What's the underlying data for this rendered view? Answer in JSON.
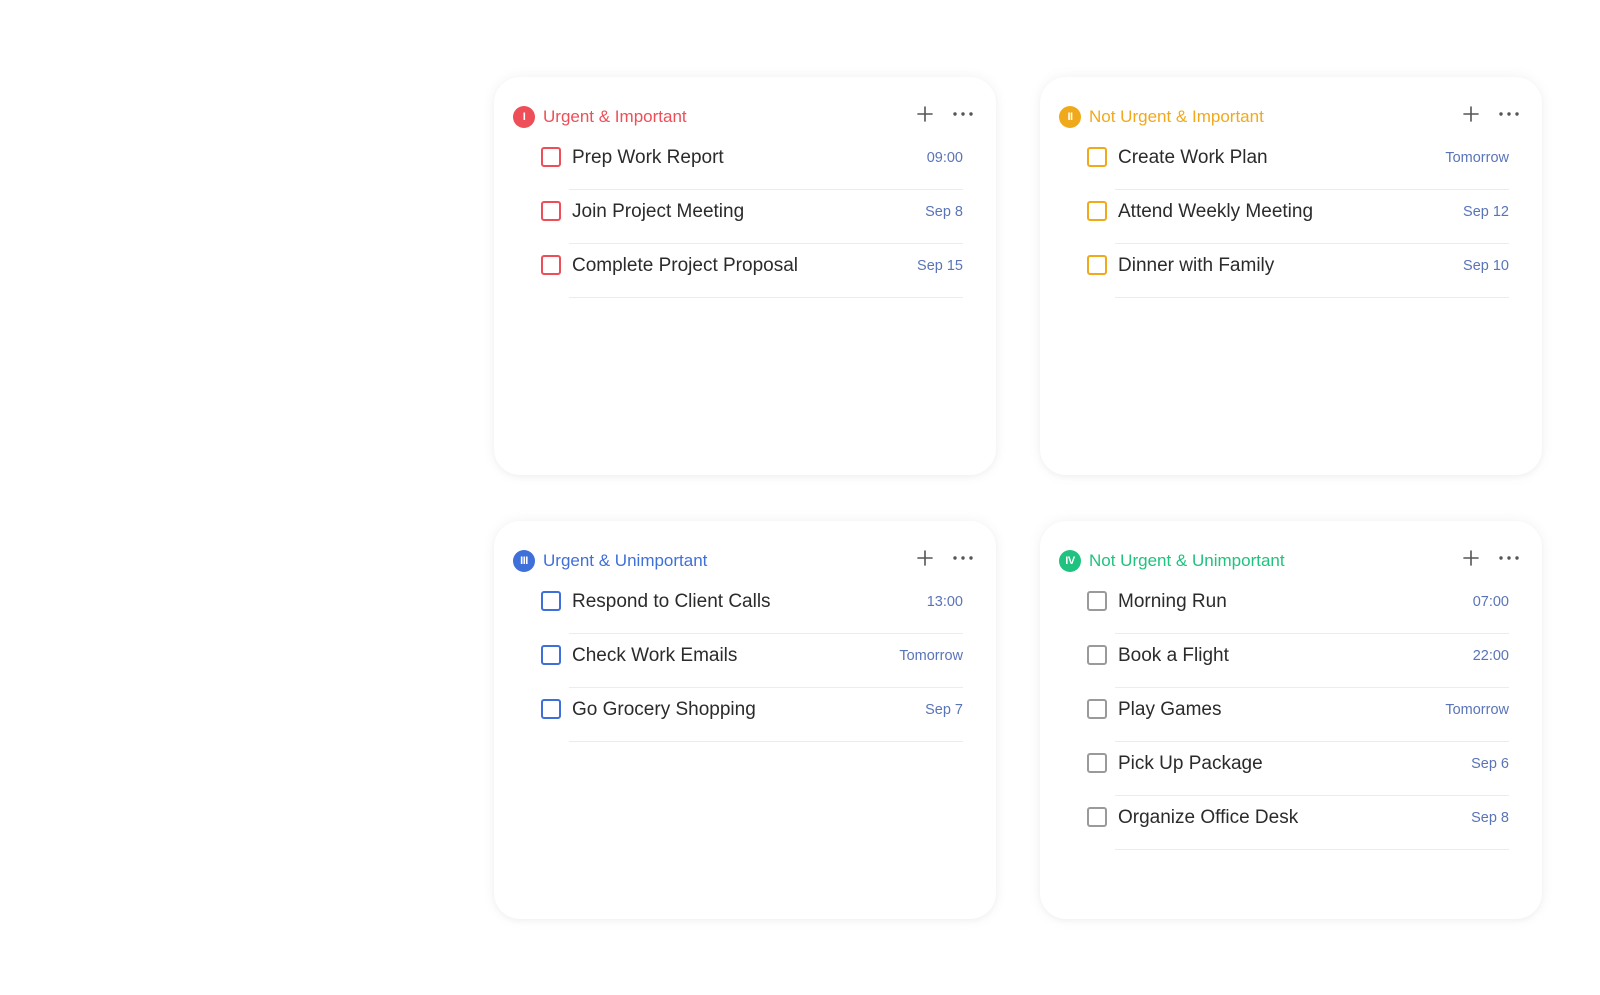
{
  "colors": {
    "q1": "#ee4e58",
    "q2": "#f1a91c",
    "q3": "#3f6fd9",
    "q4": "#1fc27e",
    "q4_checkbox": "#9a9a9a",
    "due_text": "#5a74b8"
  },
  "quadrants": [
    {
      "id": "q1",
      "badge": "I",
      "title": "Urgent & Important",
      "tasks": [
        {
          "title": "Prep Work Report",
          "due": "09:00"
        },
        {
          "title": "Join Project Meeting",
          "due": "Sep 8"
        },
        {
          "title": "Complete Project Proposal",
          "due": "Sep 15"
        }
      ]
    },
    {
      "id": "q2",
      "badge": "II",
      "title": "Not Urgent & Important",
      "tasks": [
        {
          "title": "Create Work Plan",
          "due": "Tomorrow"
        },
        {
          "title": "Attend Weekly Meeting",
          "due": "Sep 12"
        },
        {
          "title": "Dinner with Family",
          "due": "Sep 10"
        }
      ]
    },
    {
      "id": "q3",
      "badge": "III",
      "title": "Urgent & Unimportant",
      "tasks": [
        {
          "title": "Respond to Client Calls",
          "due": "13:00"
        },
        {
          "title": "Check Work Emails",
          "due": "Tomorrow"
        },
        {
          "title": "Go Grocery Shopping",
          "due": "Sep 7"
        }
      ]
    },
    {
      "id": "q4",
      "badge": "IV",
      "title": "Not Urgent & Unimportant",
      "tasks": [
        {
          "title": "Morning Run",
          "due": "07:00"
        },
        {
          "title": "Book a Flight",
          "due": "22:00"
        },
        {
          "title": "Play Games",
          "due": "Tomorrow"
        },
        {
          "title": "Pick Up Package",
          "due": "Sep 6"
        },
        {
          "title": "Organize Office Desk",
          "due": "Sep 8"
        }
      ]
    }
  ],
  "icons": {
    "add": "plus-icon",
    "more": "more-horizontal-icon"
  }
}
